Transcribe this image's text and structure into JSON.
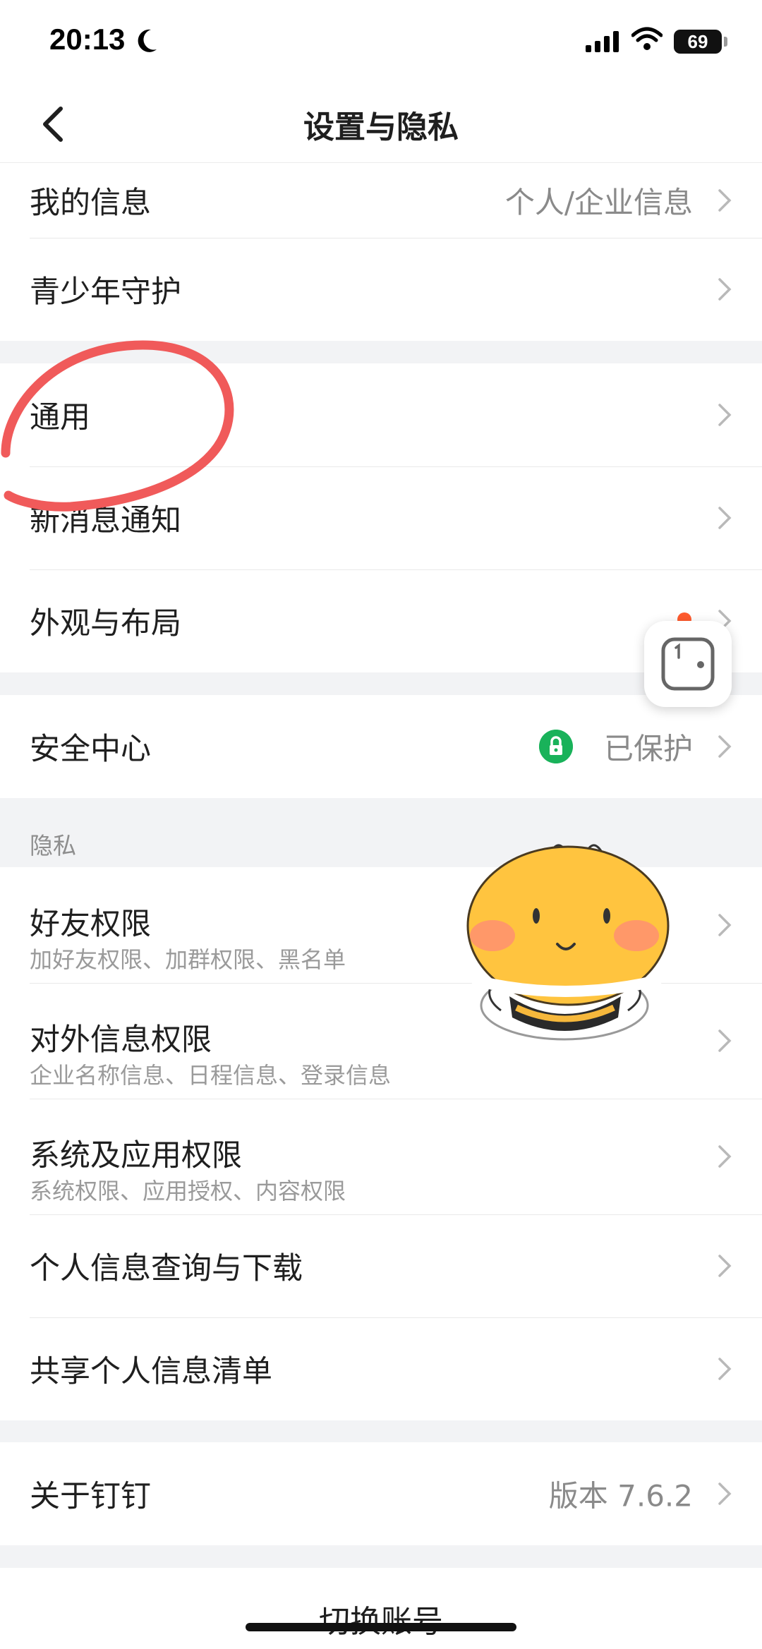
{
  "status": {
    "time": "20:13",
    "battery": "69"
  },
  "nav": {
    "title": "设置与隐私"
  },
  "group1": {
    "my_info": {
      "label": "我的信息",
      "value": "个人/企业信息"
    },
    "youth": {
      "label": "青少年守护"
    }
  },
  "group2": {
    "general": "通用",
    "notify": "新消息通知",
    "appearance": "外观与布局"
  },
  "group3": {
    "security": {
      "label": "安全中心",
      "value": "已保护"
    }
  },
  "privacy": {
    "section_title": "隐私",
    "items": [
      {
        "label": "好友权限",
        "sub": "加好友权限、加群权限、黑名单"
      },
      {
        "label": "对外信息权限",
        "sub": "企业名称信息、日程信息、登录信息"
      },
      {
        "label": "系统及应用权限",
        "sub": "系统权限、应用授权、内容权限"
      },
      {
        "label": "个人信息查询与下载"
      },
      {
        "label": "共享个人信息清单"
      }
    ]
  },
  "about": {
    "label": "关于钉钉",
    "value": "版本 7.6.2"
  },
  "bottom": {
    "switch_account": "切换账号"
  },
  "colors": {
    "accent_green": "#19b25a",
    "annotation_red": "#f05a5a",
    "badge_red": "#ff5b2e"
  },
  "icons": [
    "back-icon",
    "chevron-right-icon",
    "lock-icon",
    "moon-icon",
    "signal-icon",
    "wifi-icon",
    "battery-icon",
    "floating-window-icon",
    "bee-sticker"
  ]
}
